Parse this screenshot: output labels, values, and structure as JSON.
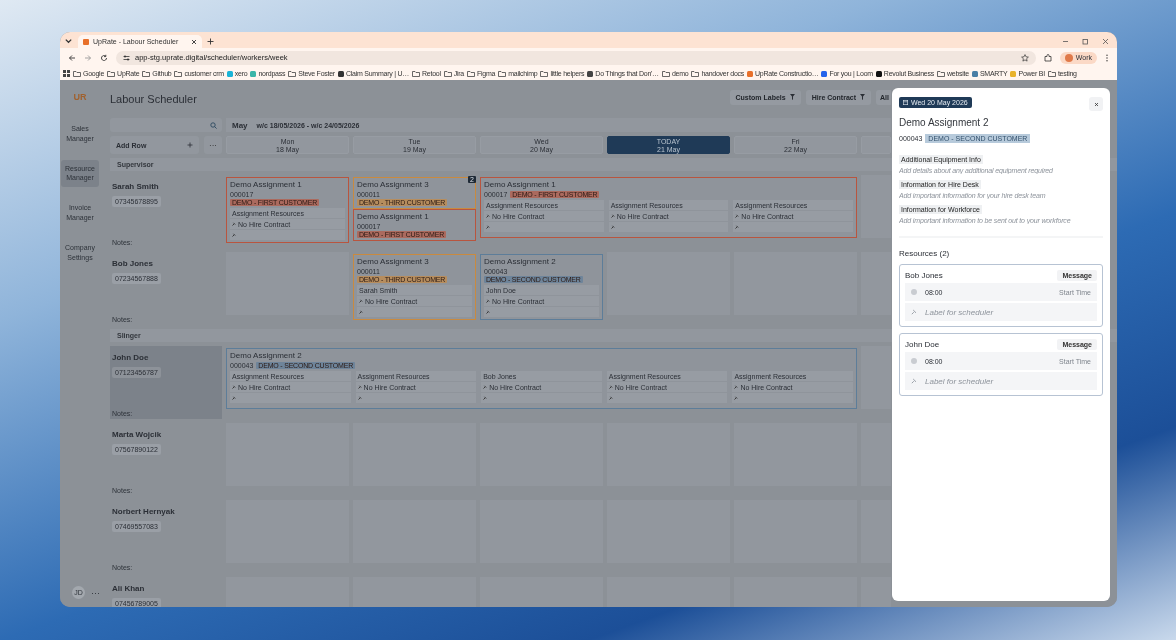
{
  "browser": {
    "tab_title": "UpRate - Labour Scheduler",
    "url": "app-stg.uprate.digital/scheduler/workers/week",
    "profile": "Work",
    "bookmarks": [
      {
        "label": "Google",
        "kind": "folder"
      },
      {
        "label": "UpRate",
        "kind": "folder"
      },
      {
        "label": "Github",
        "kind": "folder"
      },
      {
        "label": "customer crm",
        "kind": "folder"
      },
      {
        "label": "xero",
        "kind": "site",
        "color": "#1ab4d7"
      },
      {
        "label": "nordpass",
        "kind": "site",
        "color": "#3ab5a8"
      },
      {
        "label": "Steve Foster",
        "kind": "folder"
      },
      {
        "label": "Claim Summary | U…",
        "kind": "site",
        "color": "#333333"
      },
      {
        "label": "Retool",
        "kind": "folder"
      },
      {
        "label": "Jira",
        "kind": "folder"
      },
      {
        "label": "Figma",
        "kind": "folder"
      },
      {
        "label": "mailchimp",
        "kind": "folder"
      },
      {
        "label": "little helpers",
        "kind": "folder"
      },
      {
        "label": "Do Things that Don'…",
        "kind": "site",
        "color": "#444444"
      },
      {
        "label": "demo",
        "kind": "folder"
      },
      {
        "label": "handover docs",
        "kind": "folder"
      },
      {
        "label": "UpRate Constructio…",
        "kind": "site",
        "color": "#e8702a"
      },
      {
        "label": "For you | Loom",
        "kind": "site",
        "color": "#2563eb"
      },
      {
        "label": "Revolut Business",
        "kind": "site",
        "color": "#111111"
      },
      {
        "label": "website",
        "kind": "folder"
      },
      {
        "label": "SMARTY",
        "kind": "site",
        "color": "#4a7fa5"
      },
      {
        "label": "Power BI",
        "kind": "site",
        "color": "#e8b22a"
      },
      {
        "label": "testing",
        "kind": "folder"
      }
    ]
  },
  "app": {
    "logo": "UR",
    "title": "Labour Scheduler",
    "nav": [
      {
        "label": "Sales Manager",
        "selected": false
      },
      {
        "label": "Resource Manager",
        "selected": true
      },
      {
        "label": "Invoice Manager",
        "selected": false
      },
      {
        "label": "Company Settings",
        "selected": false
      }
    ],
    "user_initials": "JD",
    "more": "···",
    "filters": [
      "Custom Labels",
      "Hire Contract",
      "All"
    ],
    "add_row": "Add Row",
    "row_menu": "···",
    "month": "May",
    "week_range": "w/c 18/05/2026 - w/c 24/05/2026",
    "days": [
      {
        "weekday": "Mon",
        "date": "18 May",
        "selected": false
      },
      {
        "weekday": "Tue",
        "date": "19 May",
        "selected": false
      },
      {
        "weekday": "Wed",
        "date": "20 May",
        "selected": false
      },
      {
        "weekday": "TODAY",
        "date": "21 May",
        "selected": true
      },
      {
        "weekday": "Fri",
        "date": "22 May",
        "selected": false
      }
    ],
    "groups": [
      {
        "name": "Supervisor",
        "workers": [
          {
            "name": "Sarah Smith",
            "phone": "07345678895",
            "notes": "Notes:",
            "selected": false,
            "slots": [
              {
                "kind": "cards",
                "cards": [
                  {
                    "title": "Demo Assignment 1",
                    "ref": "000017",
                    "customer": "DEMO - FIRST CUSTOMER",
                    "color": "#b8553f",
                    "columns": [
                      {
                        "resource": "Assignment Resources",
                        "contract": "No Hire Contract"
                      }
                    ]
                  }
                ]
              },
              {
                "kind": "cards",
                "overlap_count": "2",
                "cards": [
                  {
                    "title": "Demo Assignment 3",
                    "ref": "000011",
                    "customer": "DEMO - THIRD CUSTOMER",
                    "color": "#c98a3f"
                  },
                  {
                    "title": "Demo Assignment 1",
                    "ref": "000017",
                    "customer": "DEMO - FIRST CUSTOMER",
                    "color": "#b8553f"
                  }
                ]
              },
              {
                "kind": "cards",
                "cards": [
                  {
                    "title": "Demo Assignment 1",
                    "ref": "000017",
                    "customer": "DEMO - FIRST CUSTOMER",
                    "color": "#b8553f",
                    "columns": [
                      {
                        "resource": "Assignment Resources",
                        "contract": "No Hire Contract"
                      },
                      {
                        "resource": "Assignment Resources",
                        "contract": "No Hire Contract"
                      },
                      {
                        "resource": "Assignment Resources",
                        "contract": "No Hire Contract"
                      }
                    ]
                  }
                ]
              }
            ]
          },
          {
            "name": "Bob Jones",
            "phone": "07234567888",
            "notes": "Notes:",
            "selected": false,
            "slots": [
              {
                "kind": "empty"
              },
              {
                "kind": "cards",
                "cards": [
                  {
                    "title": "Demo Assignment 3",
                    "ref": "000011",
                    "customer": "DEMO - THIRD CUSTOMER",
                    "color": "#c98a3f",
                    "columns": [
                      {
                        "resource": "Sarah Smith",
                        "contract": "No Hire Contract"
                      }
                    ]
                  }
                ]
              },
              {
                "kind": "cards",
                "cards": [
                  {
                    "title": "Demo Assignment 2",
                    "ref": "000043",
                    "customer": "DEMO - SECOND CUSTOMER",
                    "color": "#5d7d99",
                    "columns": [
                      {
                        "resource": "John Doe",
                        "contract": "No Hire Contract"
                      }
                    ]
                  }
                ]
              }
            ]
          }
        ]
      },
      {
        "name": "Slinger",
        "workers": [
          {
            "name": "John Doe",
            "phone": "07123456787",
            "notes": "Notes:",
            "selected": true,
            "slots": [
              {
                "kind": "cards",
                "cards": [
                  {
                    "title": "Demo Assignment 2",
                    "ref": "000043",
                    "customer": "DEMO - SECOND CUSTOMER",
                    "color": "#5d7d99",
                    "columns": [
                      {
                        "resource": "Assignment Resources",
                        "contract": "No Hire Contract"
                      },
                      {
                        "resource": "Assignment Resources",
                        "contract": "No Hire Contract"
                      },
                      {
                        "resource": "Bob Jones",
                        "contract": "No Hire Contract"
                      },
                      {
                        "resource": "Assignment Resources",
                        "contract": "No Hire Contract"
                      },
                      {
                        "resource": "Assignment Resources",
                        "contract": "No Hire Contract"
                      }
                    ]
                  }
                ]
              }
            ]
          },
          {
            "name": "Marta Wojcik",
            "phone": "07567890122",
            "notes": "Notes:",
            "selected": false
          },
          {
            "name": "Norbert Hernyak",
            "phone": "07469557083",
            "notes": "Notes:",
            "selected": false
          },
          {
            "name": "Ali Khan",
            "phone": "07456789005",
            "selected": false
          }
        ]
      }
    ]
  },
  "panel": {
    "date": "Wed 20 May 2026",
    "title": "Demo Assignment 2",
    "ref": "000043",
    "customer": "DEMO - SECOND CUSTOMER",
    "info": [
      {
        "label": "Additional Equipment Info",
        "placeholder": "Add details about any additional equipment required"
      },
      {
        "label": "Information for Hire Desk",
        "placeholder": "Add important information for your hire desk team"
      },
      {
        "label": "Information for Workforce",
        "placeholder": "Add important information to be sent out to your workforce"
      }
    ],
    "resources_heading": "Resources (2)",
    "resources": [
      {
        "name": "Bob Jones",
        "action": "Message",
        "time": "08:00",
        "time_label": "Start Time",
        "label_placeholder": "Label for scheduler"
      },
      {
        "name": "John Doe",
        "action": "Message",
        "time": "08:00",
        "time_label": "Start Time",
        "label_placeholder": "Label for scheduler"
      }
    ]
  }
}
